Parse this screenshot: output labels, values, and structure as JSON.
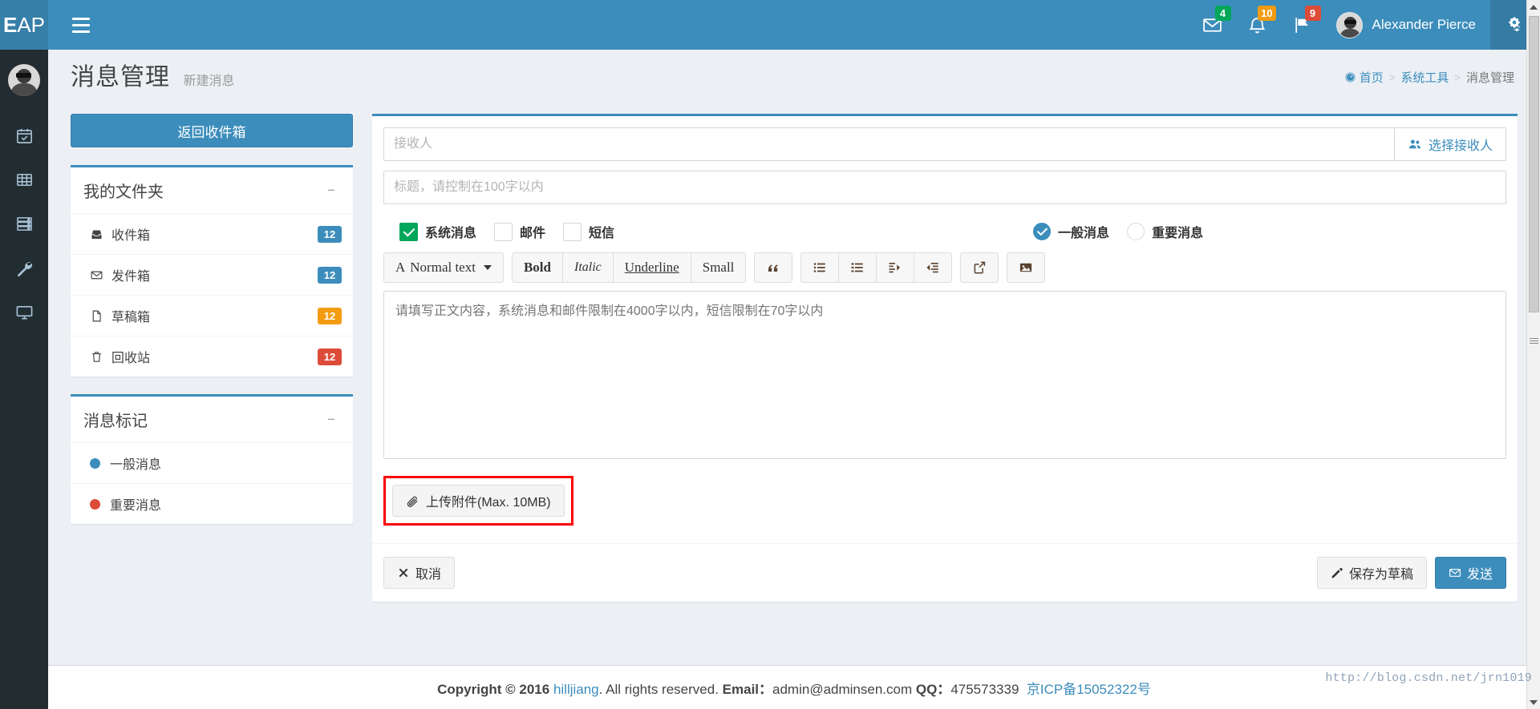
{
  "app": {
    "logo_short": "E",
    "logo_rest": "AP"
  },
  "header": {
    "user_name": "Alexander Pierce",
    "icons": [
      {
        "name": "envelope-icon",
        "badge": "4"
      },
      {
        "name": "bell-icon",
        "badge": "10"
      },
      {
        "name": "flag-icon",
        "badge": "9"
      }
    ]
  },
  "content_header": {
    "title": "消息管理",
    "subtitle": "新建消息"
  },
  "breadcrumb": {
    "home": "首页",
    "section": "系统工具",
    "current": "消息管理",
    "separator": ">"
  },
  "left": {
    "back_button": "返回收件箱",
    "folders_box": {
      "title": "我的文件夹",
      "collapse": "−",
      "items": [
        {
          "label": "收件箱",
          "badge": "12",
          "badge_color": "b-blue",
          "icon": "inbox-icon"
        },
        {
          "label": "发件箱",
          "badge": "12",
          "badge_color": "b-blue",
          "icon": "envelope-o-icon"
        },
        {
          "label": "草稿箱",
          "badge": "12",
          "badge_color": "b-orange",
          "icon": "file-text-icon"
        },
        {
          "label": "回收站",
          "badge": "12",
          "badge_color": "b-red",
          "icon": "trash-icon"
        }
      ]
    },
    "labels_box": {
      "title": "消息标记",
      "collapse": "−",
      "items": [
        {
          "label": "一般消息",
          "dot": "dot-blue"
        },
        {
          "label": "重要消息",
          "dot": "dot-red"
        }
      ]
    }
  },
  "compose": {
    "to_placeholder": "接收人",
    "to_value": "",
    "pick_recipient": "选择接收人",
    "subject_placeholder": "标题，请控制在100字以内",
    "subject_value": "",
    "channels": [
      {
        "label": "系统消息",
        "checked": true
      },
      {
        "label": "邮件",
        "checked": false
      },
      {
        "label": "短信",
        "checked": false
      }
    ],
    "priority": [
      {
        "label": "一般消息",
        "checked": true
      },
      {
        "label": "重要消息",
        "checked": false
      }
    ],
    "toolbar": {
      "style_label": "Normal text",
      "bold": "Bold",
      "italic": "Italic",
      "underline": "Underline",
      "small": "Small",
      "icons": [
        "quote-icon",
        "unordered-list-icon",
        "ordered-list-icon",
        "indent-icon",
        "outdent-icon",
        "link-share-icon",
        "image-icon"
      ]
    },
    "body_placeholder": "请填写正文内容，系统消息和邮件限制在4000字以内，短信限制在70字以内",
    "body_value": "",
    "attach_label": "上传附件(Max. 10MB)",
    "cancel_label": "取消",
    "save_draft_label": "保存为草稿",
    "send_label": "发送"
  },
  "footer": {
    "copyright_prefix": "Copyright © 2016",
    "brand": "hilljiang",
    "rights": ". All rights reserved.",
    "email_label": "Email：",
    "email": "admin@adminsen.com",
    "qq_label": "QQ：",
    "qq": "475573339",
    "icp": "京ICP备15052322号"
  },
  "watermark": "http://blog.csdn.net/jrn1019",
  "colors": {
    "brand_blue": "#3c8dbc",
    "sidebar_dark": "#222d32",
    "green": "#00a65a",
    "orange": "#f39c12",
    "red": "#dd4b39",
    "highlight_red": "#ff0000"
  }
}
